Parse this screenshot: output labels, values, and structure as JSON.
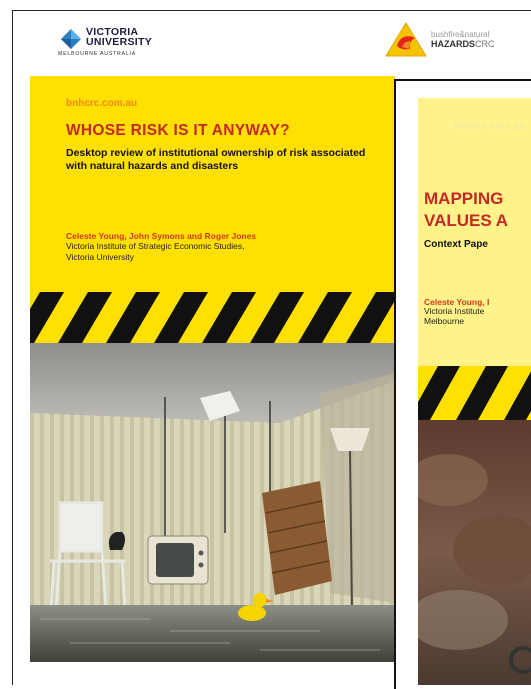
{
  "logos": {
    "vu_line1": "VICTORIA",
    "vu_line2": "UNIVERSITY",
    "vu_sub": "MELBOURNE AUSTRALIA",
    "bnh_line1": "bushfire&natural",
    "bnh_line2": "HAZARDS",
    "bnh_crc": "CRC"
  },
  "cover1": {
    "url": "bnhcrc.com.au",
    "title": "WHOSE RISK IS IT ANYWAY?",
    "subtitle": "Desktop review of institutional ownership of risk associated with natural hazards and disasters",
    "authors": "Celeste Young, John Symons and Roger Jones",
    "institution_line1": "Victoria Institute of Strategic Economic Studies,",
    "institution_line2": "Victoria University"
  },
  "cover2": {
    "url": "bnhcrc.com.au",
    "title_line1": "MAPPING",
    "title_line2": "VALUES A",
    "subtitle": "Context Pape",
    "authors": "Celeste Young, I",
    "institution_line1": "Victoria Institute",
    "institution_line2": "Melbourne"
  },
  "colors": {
    "cover_yellow": "#ffe000",
    "cover2_yellow": "#fff38a",
    "title_red": "#c62828",
    "author_orange": "#d23a1a",
    "url_orange": "#f08a1c"
  }
}
